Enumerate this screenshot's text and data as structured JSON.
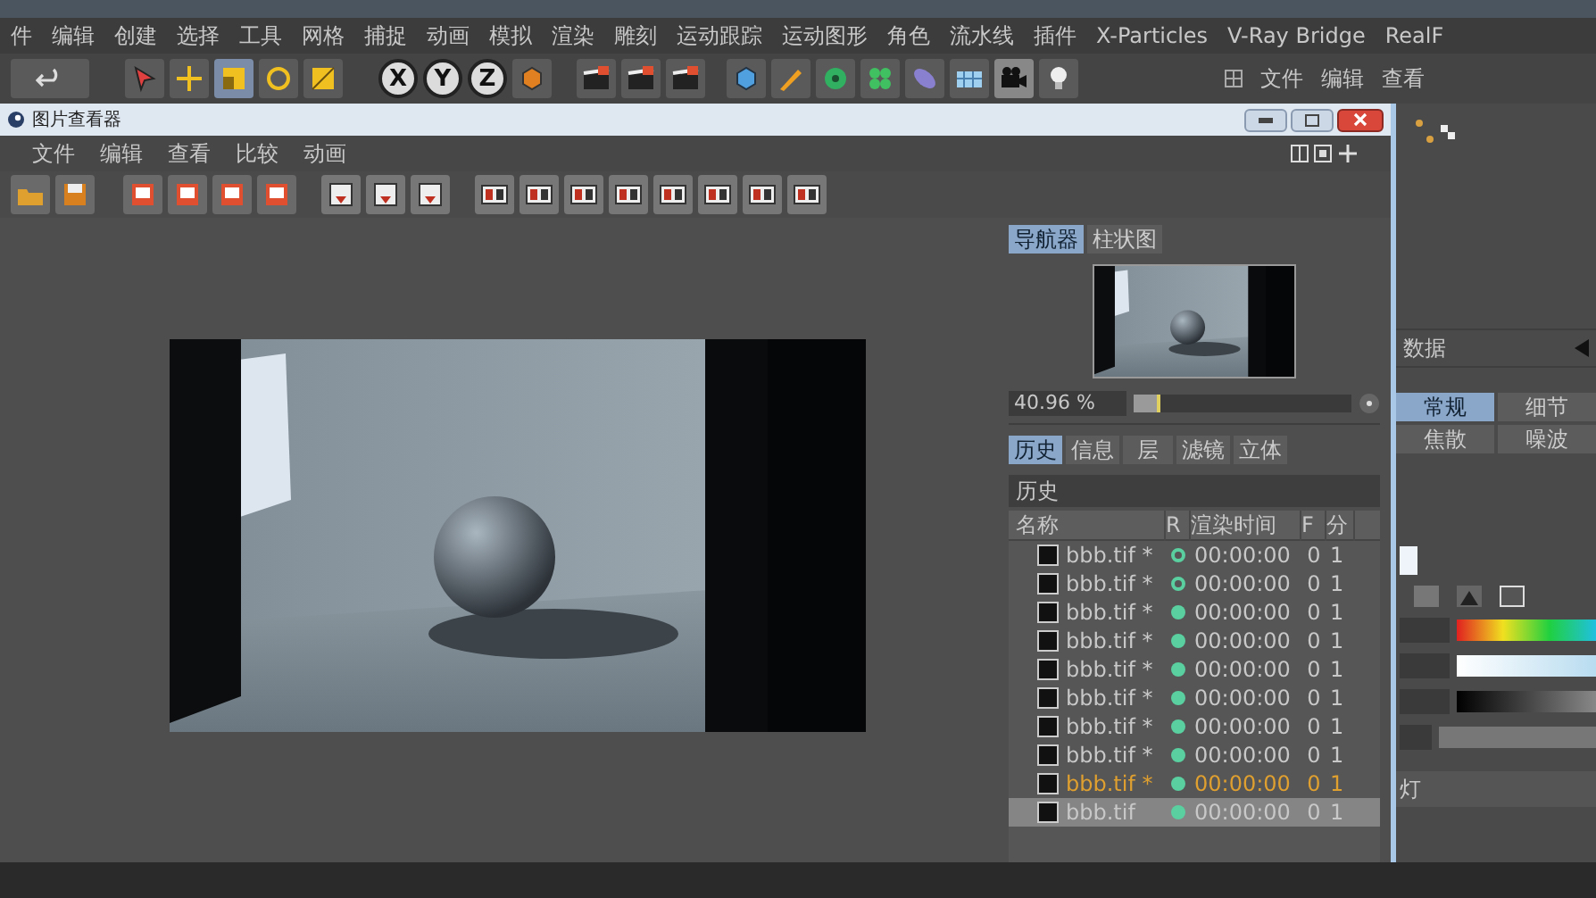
{
  "main_menu": [
    "件",
    "编辑",
    "创建",
    "选择",
    "工具",
    "网格",
    "捕捉",
    "动画",
    "模拟",
    "渲染",
    "雕刻",
    "运动跟踪",
    "运动图形",
    "角色",
    "流水线",
    "插件",
    "X-Particles",
    "V-Ray Bridge",
    "RealF"
  ],
  "axis_buttons": [
    "X",
    "Y",
    "Z"
  ],
  "right_menu": [
    "文件",
    "编辑",
    "查看"
  ],
  "viewer": {
    "title": "图片查看器",
    "menu": [
      "文件",
      "编辑",
      "查看",
      "比较",
      "动画"
    ],
    "navigator_tabs": [
      {
        "label": "导航器",
        "selected": true
      },
      {
        "label": "柱状图",
        "selected": false
      }
    ],
    "zoom": {
      "value": "40.96 %",
      "level": 0.12
    },
    "panel_tabs": [
      {
        "label": "历史",
        "selected": true
      },
      {
        "label": "信息",
        "selected": false
      },
      {
        "label": "层",
        "selected": false
      },
      {
        "label": "滤镜",
        "selected": false
      },
      {
        "label": "立体",
        "selected": false
      }
    ],
    "history": {
      "title": "历史",
      "columns": [
        "名称",
        "R",
        "渲染时间",
        "F",
        "分"
      ],
      "rows": [
        {
          "name": "bbb.tif *",
          "complete": false,
          "time": "00:00:00",
          "f": "0",
          "column_5": "1",
          "highlighted": false,
          "selected": false
        },
        {
          "name": "bbb.tif *",
          "complete": false,
          "time": "00:00:00",
          "f": "0",
          "column_5": "1",
          "highlighted": false,
          "selected": false
        },
        {
          "name": "bbb.tif *",
          "complete": true,
          "time": "00:00:00",
          "f": "0",
          "column_5": "1",
          "highlighted": false,
          "selected": false
        },
        {
          "name": "bbb.tif *",
          "complete": true,
          "time": "00:00:00",
          "f": "0",
          "column_5": "1",
          "highlighted": false,
          "selected": false
        },
        {
          "name": "bbb.tif *",
          "complete": true,
          "time": "00:00:00",
          "f": "0",
          "column_5": "1",
          "highlighted": false,
          "selected": false
        },
        {
          "name": "bbb.tif *",
          "complete": true,
          "time": "00:00:00",
          "f": "0",
          "column_5": "1",
          "highlighted": false,
          "selected": false
        },
        {
          "name": "bbb.tif *",
          "complete": true,
          "time": "00:00:00",
          "f": "0",
          "column_5": "1",
          "highlighted": false,
          "selected": false
        },
        {
          "name": "bbb.tif *",
          "complete": true,
          "time": "00:00:00",
          "f": "0",
          "column_5": "1",
          "highlighted": false,
          "selected": false
        },
        {
          "name": "bbb.tif *",
          "complete": true,
          "time": "00:00:00",
          "f": "0",
          "column_5": "1",
          "highlighted": true,
          "selected": false
        },
        {
          "name": "bbb.tif",
          "complete": true,
          "time": "00:00:00",
          "f": "0",
          "column_5": "1",
          "highlighted": false,
          "selected": true
        }
      ]
    }
  },
  "attributes": {
    "title": "数据",
    "tabs": [
      {
        "label": "常规",
        "selected": true
      },
      {
        "label": "细节",
        "selected": false
      },
      {
        "label": "焦散",
        "selected": false
      },
      {
        "label": "噪波",
        "selected": false
      }
    ],
    "section": "灯"
  }
}
